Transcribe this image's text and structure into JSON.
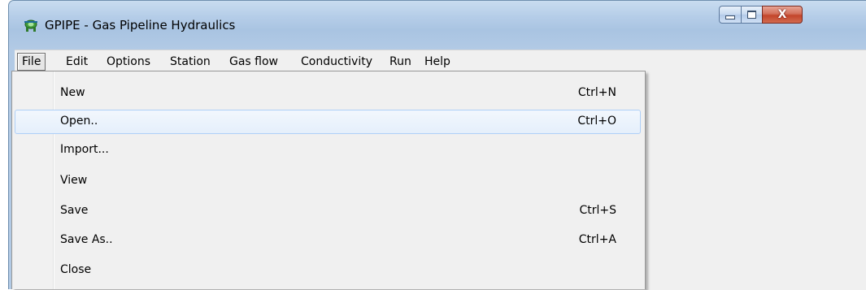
{
  "window": {
    "title": "GPIPE - Gas Pipeline Hydraulics",
    "icon": "gas-pipeline-app-icon",
    "controls": {
      "minimize": "minimize-icon",
      "maximize": "maximize-icon",
      "close": "close-icon"
    }
  },
  "menubar": {
    "items": [
      "File",
      "Edit",
      "Options",
      "Station",
      "Gas flow",
      "Conductivity",
      "Run",
      "Help"
    ],
    "active": "File"
  },
  "file_menu": {
    "items": [
      {
        "label": "New",
        "shortcut": "Ctrl+N"
      },
      {
        "label": "Open..",
        "shortcut": "Ctrl+O"
      },
      {
        "label": "Import...",
        "shortcut": ""
      },
      {
        "label": "View",
        "shortcut": ""
      },
      {
        "label": "Save",
        "shortcut": "Ctrl+S"
      },
      {
        "label": "Save As..",
        "shortcut": "Ctrl+A"
      },
      {
        "label": "Close",
        "shortcut": ""
      }
    ],
    "highlighted": "Open.."
  },
  "colors": {
    "titlebar": "#b5cde8",
    "menu_background": "#f0f0f0",
    "hover_border": "#aecff7",
    "close_button": "#c3452b"
  }
}
